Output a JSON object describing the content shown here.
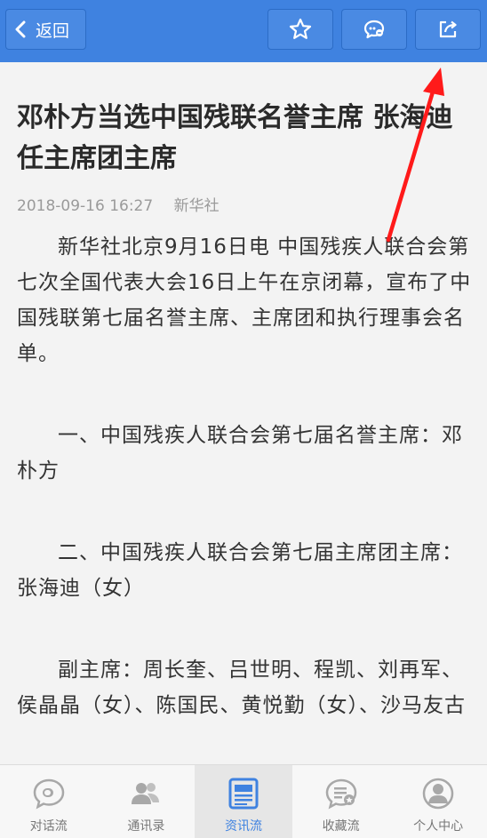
{
  "header": {
    "back_label": "返回",
    "favorite_icon": "star-icon",
    "comment_icon": "comment-icon",
    "share_icon": "share-icon",
    "accent_color": "#3f82e0"
  },
  "article": {
    "title": "邓朴方当选中国残联名誉主席 张海迪任主席团主席",
    "date": "2018-09-16 16:27",
    "source": "新华社",
    "paragraphs": [
      "新华社北京9月16日电 中国残疾人联合会第七次全国代表大会16日上午在京闭幕，宣布了中国残联第七届名誉主席、主席团和执行理事会名单。",
      "一、中国残疾人联合会第七届名誉主席：邓朴方",
      "二、中国残疾人联合会第七届主席团主席：张海迪（女）",
      "副主席：周长奎、吕世明、程凯、刘再军、侯晶晶（女）、陈国民、黄悦勤（女）、沙马友古"
    ]
  },
  "tabs": [
    {
      "label": "对话流",
      "icon": "chat-bubble-icon",
      "active": false
    },
    {
      "label": "通讯录",
      "icon": "contacts-icon",
      "active": false
    },
    {
      "label": "资讯流",
      "icon": "news-icon",
      "active": true
    },
    {
      "label": "收藏流",
      "icon": "favorites-icon",
      "active": false
    },
    {
      "label": "个人中心",
      "icon": "profile-icon",
      "active": false
    }
  ],
  "annotation": {
    "color": "#ff1a1a"
  }
}
